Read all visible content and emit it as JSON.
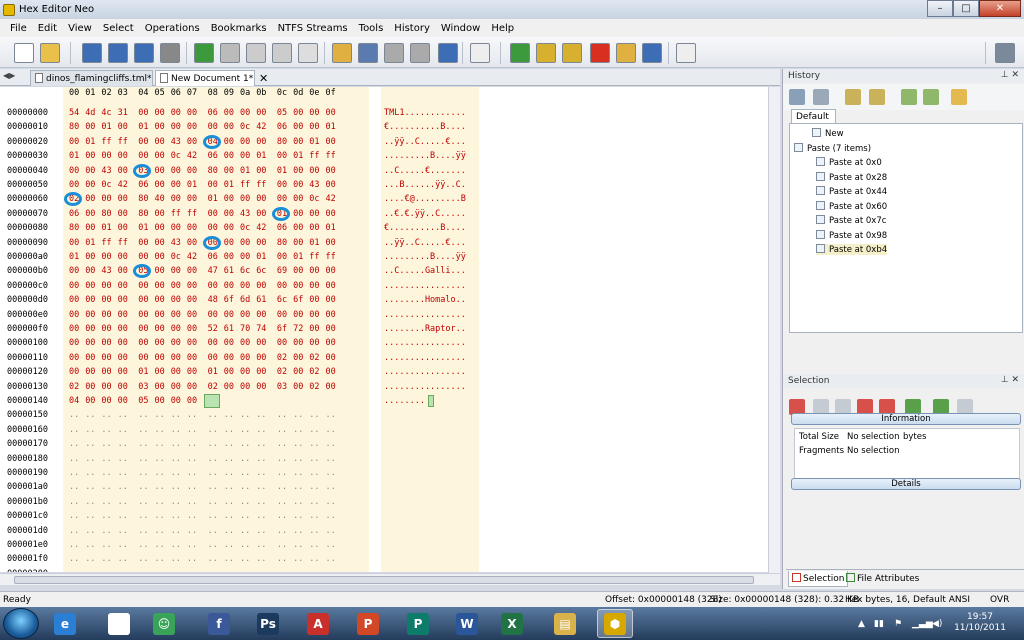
{
  "window": {
    "title": "Hex Editor Neo",
    "min": "–",
    "max": "□",
    "close": "✕"
  },
  "menu": [
    "File",
    "Edit",
    "View",
    "Select",
    "Operations",
    "Bookmarks",
    "NTFS Streams",
    "Tools",
    "History",
    "Window",
    "Help"
  ],
  "tabs": [
    {
      "label": "dinos_flamingcliffs.tml*",
      "active": false
    },
    {
      "label": "New Document 1*",
      "active": true
    }
  ],
  "tab_close": "✕",
  "hex": {
    "columns": [
      "00",
      "01",
      "02",
      "03",
      "04",
      "05",
      "06",
      "07",
      "08",
      "09",
      "0a",
      "0b",
      "0c",
      "0d",
      "0e",
      "0f"
    ],
    "rows": [
      {
        "addr": "00000000",
        "bytes": [
          "54",
          "4d",
          "4c",
          "31",
          "00",
          "00",
          "00",
          "00",
          "06",
          "00",
          "00",
          "00",
          "05",
          "00",
          "00",
          "00"
        ],
        "ascii": "TML1............"
      },
      {
        "addr": "00000010",
        "bytes": [
          "80",
          "00",
          "01",
          "00",
          "01",
          "00",
          "00",
          "00",
          "00",
          "00",
          "0c",
          "42",
          "06",
          "00",
          "00",
          "01"
        ],
        "ascii": "€..........B...."
      },
      {
        "addr": "00000020",
        "bytes": [
          "00",
          "01",
          "ff",
          "ff",
          "00",
          "00",
          "43",
          "00",
          "04",
          "00",
          "00",
          "00",
          "80",
          "00",
          "01",
          "00"
        ],
        "ascii": "..ÿÿ..C.....€..."
      },
      {
        "addr": "00000030",
        "bytes": [
          "01",
          "00",
          "00",
          "00",
          "00",
          "00",
          "0c",
          "42",
          "06",
          "00",
          "00",
          "01",
          "00",
          "01",
          "ff",
          "ff"
        ],
        "ascii": ".........B....ÿÿ"
      },
      {
        "addr": "00000040",
        "bytes": [
          "00",
          "00",
          "43",
          "00",
          "03",
          "00",
          "00",
          "00",
          "80",
          "00",
          "01",
          "00",
          "01",
          "00",
          "00",
          "00"
        ],
        "ascii": "..C.....€......."
      },
      {
        "addr": "00000050",
        "bytes": [
          "00",
          "00",
          "0c",
          "42",
          "06",
          "00",
          "00",
          "01",
          "00",
          "01",
          "ff",
          "ff",
          "00",
          "00",
          "43",
          "00"
        ],
        "ascii": "...B......ÿÿ..C."
      },
      {
        "addr": "00000060",
        "bytes": [
          "02",
          "00",
          "00",
          "00",
          "80",
          "40",
          "00",
          "00",
          "01",
          "00",
          "00",
          "00",
          "00",
          "00",
          "0c",
          "42"
        ],
        "ascii": "....€@.........B"
      },
      {
        "addr": "00000070",
        "bytes": [
          "06",
          "00",
          "80",
          "00",
          "80",
          "00",
          "ff",
          "ff",
          "00",
          "00",
          "43",
          "00",
          "01",
          "00",
          "00",
          "00"
        ],
        "ascii": "..€.€.ÿÿ..C....."
      },
      {
        "addr": "00000080",
        "bytes": [
          "80",
          "00",
          "01",
          "00",
          "01",
          "00",
          "00",
          "00",
          "00",
          "00",
          "0c",
          "42",
          "06",
          "00",
          "00",
          "01"
        ],
        "ascii": "€..........B...."
      },
      {
        "addr": "00000090",
        "bytes": [
          "00",
          "01",
          "ff",
          "ff",
          "00",
          "00",
          "43",
          "00",
          "00",
          "00",
          "00",
          "00",
          "80",
          "00",
          "01",
          "00"
        ],
        "ascii": "..ÿÿ..C.....€..."
      },
      {
        "addr": "000000a0",
        "bytes": [
          "01",
          "00",
          "00",
          "00",
          "00",
          "00",
          "0c",
          "42",
          "06",
          "00",
          "00",
          "01",
          "00",
          "01",
          "ff",
          "ff"
        ],
        "ascii": ".........B....ÿÿ"
      },
      {
        "addr": "000000b0",
        "bytes": [
          "00",
          "00",
          "43",
          "00",
          "05",
          "00",
          "00",
          "00",
          "47",
          "61",
          "6c",
          "6c",
          "69",
          "00",
          "00",
          "00"
        ],
        "ascii": "..C.....Galli..."
      },
      {
        "addr": "000000c0",
        "bytes": [
          "00",
          "00",
          "00",
          "00",
          "00",
          "00",
          "00",
          "00",
          "00",
          "00",
          "00",
          "00",
          "00",
          "00",
          "00",
          "00"
        ],
        "ascii": "................"
      },
      {
        "addr": "000000d0",
        "bytes": [
          "00",
          "00",
          "00",
          "00",
          "00",
          "00",
          "00",
          "00",
          "48",
          "6f",
          "6d",
          "61",
          "6c",
          "6f",
          "00",
          "00"
        ],
        "ascii": "........Homalo.."
      },
      {
        "addr": "000000e0",
        "bytes": [
          "00",
          "00",
          "00",
          "00",
          "00",
          "00",
          "00",
          "00",
          "00",
          "00",
          "00",
          "00",
          "00",
          "00",
          "00",
          "00"
        ],
        "ascii": "................"
      },
      {
        "addr": "000000f0",
        "bytes": [
          "00",
          "00",
          "00",
          "00",
          "00",
          "00",
          "00",
          "00",
          "52",
          "61",
          "70",
          "74",
          "6f",
          "72",
          "00",
          "00"
        ],
        "ascii": "........Raptor.."
      },
      {
        "addr": "00000100",
        "bytes": [
          "00",
          "00",
          "00",
          "00",
          "00",
          "00",
          "00",
          "00",
          "00",
          "00",
          "00",
          "00",
          "00",
          "00",
          "00",
          "00"
        ],
        "ascii": "................"
      },
      {
        "addr": "00000110",
        "bytes": [
          "00",
          "00",
          "00",
          "00",
          "00",
          "00",
          "00",
          "00",
          "00",
          "00",
          "00",
          "00",
          "02",
          "00",
          "02",
          "00"
        ],
        "ascii": "................"
      },
      {
        "addr": "00000120",
        "bytes": [
          "00",
          "00",
          "00",
          "00",
          "01",
          "00",
          "00",
          "00",
          "01",
          "00",
          "00",
          "00",
          "02",
          "00",
          "02",
          "00"
        ],
        "ascii": "................"
      },
      {
        "addr": "00000130",
        "bytes": [
          "02",
          "00",
          "00",
          "00",
          "03",
          "00",
          "00",
          "00",
          "02",
          "00",
          "00",
          "00",
          "03",
          "00",
          "02",
          "00"
        ],
        "ascii": "................"
      },
      {
        "addr": "00000140",
        "bytes": [
          "04",
          "00",
          "00",
          "00",
          "05",
          "00",
          "00",
          "00",
          "..",
          "",
          "",
          "",
          "",
          "",
          "",
          ""
        ],
        "ascii": "........"
      },
      {
        "addr": "00000150",
        "bytes": [
          "..",
          "..",
          "..",
          "..",
          "..",
          "..",
          "..",
          "..",
          "..",
          "..",
          "..",
          "..",
          "..",
          "..",
          "..",
          ".."
        ],
        "ascii": ""
      },
      {
        "addr": "00000160",
        "bytes": [
          "..",
          "..",
          "..",
          "..",
          "..",
          "..",
          "..",
          "..",
          "..",
          "..",
          "..",
          "..",
          "..",
          "..",
          "..",
          ".."
        ],
        "ascii": ""
      },
      {
        "addr": "00000170",
        "bytes": [
          "..",
          "..",
          "..",
          "..",
          "..",
          "..",
          "..",
          "..",
          "..",
          "..",
          "..",
          "..",
          "..",
          "..",
          "..",
          ".."
        ],
        "ascii": ""
      },
      {
        "addr": "00000180",
        "bytes": [
          "..",
          "..",
          "..",
          "..",
          "..",
          "..",
          "..",
          "..",
          "..",
          "..",
          "..",
          "..",
          "..",
          "..",
          "..",
          ".."
        ],
        "ascii": ""
      },
      {
        "addr": "00000190",
        "bytes": [
          "..",
          "..",
          "..",
          "..",
          "..",
          "..",
          "..",
          "..",
          "..",
          "..",
          "..",
          "..",
          "..",
          "..",
          "..",
          ".."
        ],
        "ascii": ""
      },
      {
        "addr": "000001a0",
        "bytes": [
          "..",
          "..",
          "..",
          "..",
          "..",
          "..",
          "..",
          "..",
          "..",
          "..",
          "..",
          "..",
          "..",
          "..",
          "..",
          ".."
        ],
        "ascii": ""
      },
      {
        "addr": "000001b0",
        "bytes": [
          "..",
          "..",
          "..",
          "..",
          "..",
          "..",
          "..",
          "..",
          "..",
          "..",
          "..",
          "..",
          "..",
          "..",
          "..",
          ".."
        ],
        "ascii": ""
      },
      {
        "addr": "000001c0",
        "bytes": [
          "..",
          "..",
          "..",
          "..",
          "..",
          "..",
          "..",
          "..",
          "..",
          "..",
          "..",
          "..",
          "..",
          "..",
          "..",
          ".."
        ],
        "ascii": ""
      },
      {
        "addr": "000001d0",
        "bytes": [
          "..",
          "..",
          "..",
          "..",
          "..",
          "..",
          "..",
          "..",
          "..",
          "..",
          "..",
          "..",
          "..",
          "..",
          "..",
          ".."
        ],
        "ascii": ""
      },
      {
        "addr": "000001e0",
        "bytes": [
          "..",
          "..",
          "..",
          "..",
          "..",
          "..",
          "..",
          "..",
          "..",
          "..",
          "..",
          "..",
          "..",
          "..",
          "..",
          ".."
        ],
        "ascii": ""
      },
      {
        "addr": "000001f0",
        "bytes": [
          "..",
          "..",
          "..",
          "..",
          "..",
          "..",
          "..",
          "..",
          "..",
          "..",
          "..",
          "..",
          "..",
          "..",
          "..",
          ".."
        ],
        "ascii": ""
      },
      {
        "addr": "00000200",
        "bytes": [
          "..",
          "..",
          "..",
          "..",
          "..",
          "..",
          "..",
          "..",
          "..",
          "..",
          "..",
          "..",
          "..",
          "..",
          "..",
          ".."
        ],
        "ascii": ""
      }
    ],
    "circled": [
      [
        2,
        8
      ],
      [
        4,
        4
      ],
      [
        6,
        0
      ],
      [
        7,
        12
      ],
      [
        9,
        8
      ],
      [
        11,
        4
      ]
    ],
    "cursor": {
      "row": 20,
      "col": 8
    }
  },
  "history": {
    "title": "History",
    "subtab": "Default",
    "items": [
      {
        "label": "New",
        "level": 1
      },
      {
        "label": "Paste (7 items)",
        "level": 0
      },
      {
        "label": "Paste at 0x0",
        "level": 2
      },
      {
        "label": "Paste at 0x28",
        "level": 2
      },
      {
        "label": "Paste at 0x44",
        "level": 2
      },
      {
        "label": "Paste at 0x60",
        "level": 2
      },
      {
        "label": "Paste at 0x7c",
        "level": 2
      },
      {
        "label": "Paste at 0x98",
        "level": 2
      },
      {
        "label": "Paste at 0xb4",
        "level": 2,
        "selected": true
      }
    ]
  },
  "selection": {
    "title": "Selection",
    "info_label": "Information",
    "details_label": "Details",
    "total_size_label": "Total Size",
    "total_size_value": "No selection",
    "total_size_unit": "bytes",
    "fragments_label": "Fragments",
    "fragments_value": "No selection"
  },
  "bottom_tabs": [
    "Selection",
    "File Attributes"
  ],
  "status": {
    "left": "Ready",
    "offset": "Offset: 0x00000148 (328)",
    "size": "Size: 0x00000148 (328): 0.32 KB",
    "mode": "Hex bytes, 16, Default ANSI",
    "ovr": "OVR"
  },
  "taskbar": {
    "apps": [
      {
        "name": "internet-explorer",
        "glyph": "e",
        "color": "#2a7fd4"
      },
      {
        "name": "blank-document",
        "glyph": "",
        "color": "#ffffff"
      },
      {
        "name": "messenger",
        "glyph": "☺",
        "color": "#3aa35a"
      },
      {
        "name": "facebook",
        "glyph": "f",
        "color": "#3b5998"
      },
      {
        "name": "photoshop",
        "glyph": "Ps",
        "color": "#1c3a5e"
      },
      {
        "name": "acrobat",
        "glyph": "A",
        "color": "#c9302c"
      },
      {
        "name": "powerpoint",
        "glyph": "P",
        "color": "#d24726"
      },
      {
        "name": "publisher",
        "glyph": "P",
        "color": "#0e7c6b"
      },
      {
        "name": "word",
        "glyph": "W",
        "color": "#2b579a"
      },
      {
        "name": "excel",
        "glyph": "X",
        "color": "#217346"
      },
      {
        "name": "explorer",
        "glyph": "▤",
        "color": "#d9b24c"
      },
      {
        "name": "hex-editor",
        "glyph": "⬢",
        "color": "#d6a800"
      }
    ],
    "time": "19:57",
    "date": "11/10/2011",
    "tray_arrow": "▲"
  },
  "colors": {
    "hex_text": "#c00000",
    "circle": "#1a8fd8",
    "col_highlight": "#fdf6dc"
  }
}
